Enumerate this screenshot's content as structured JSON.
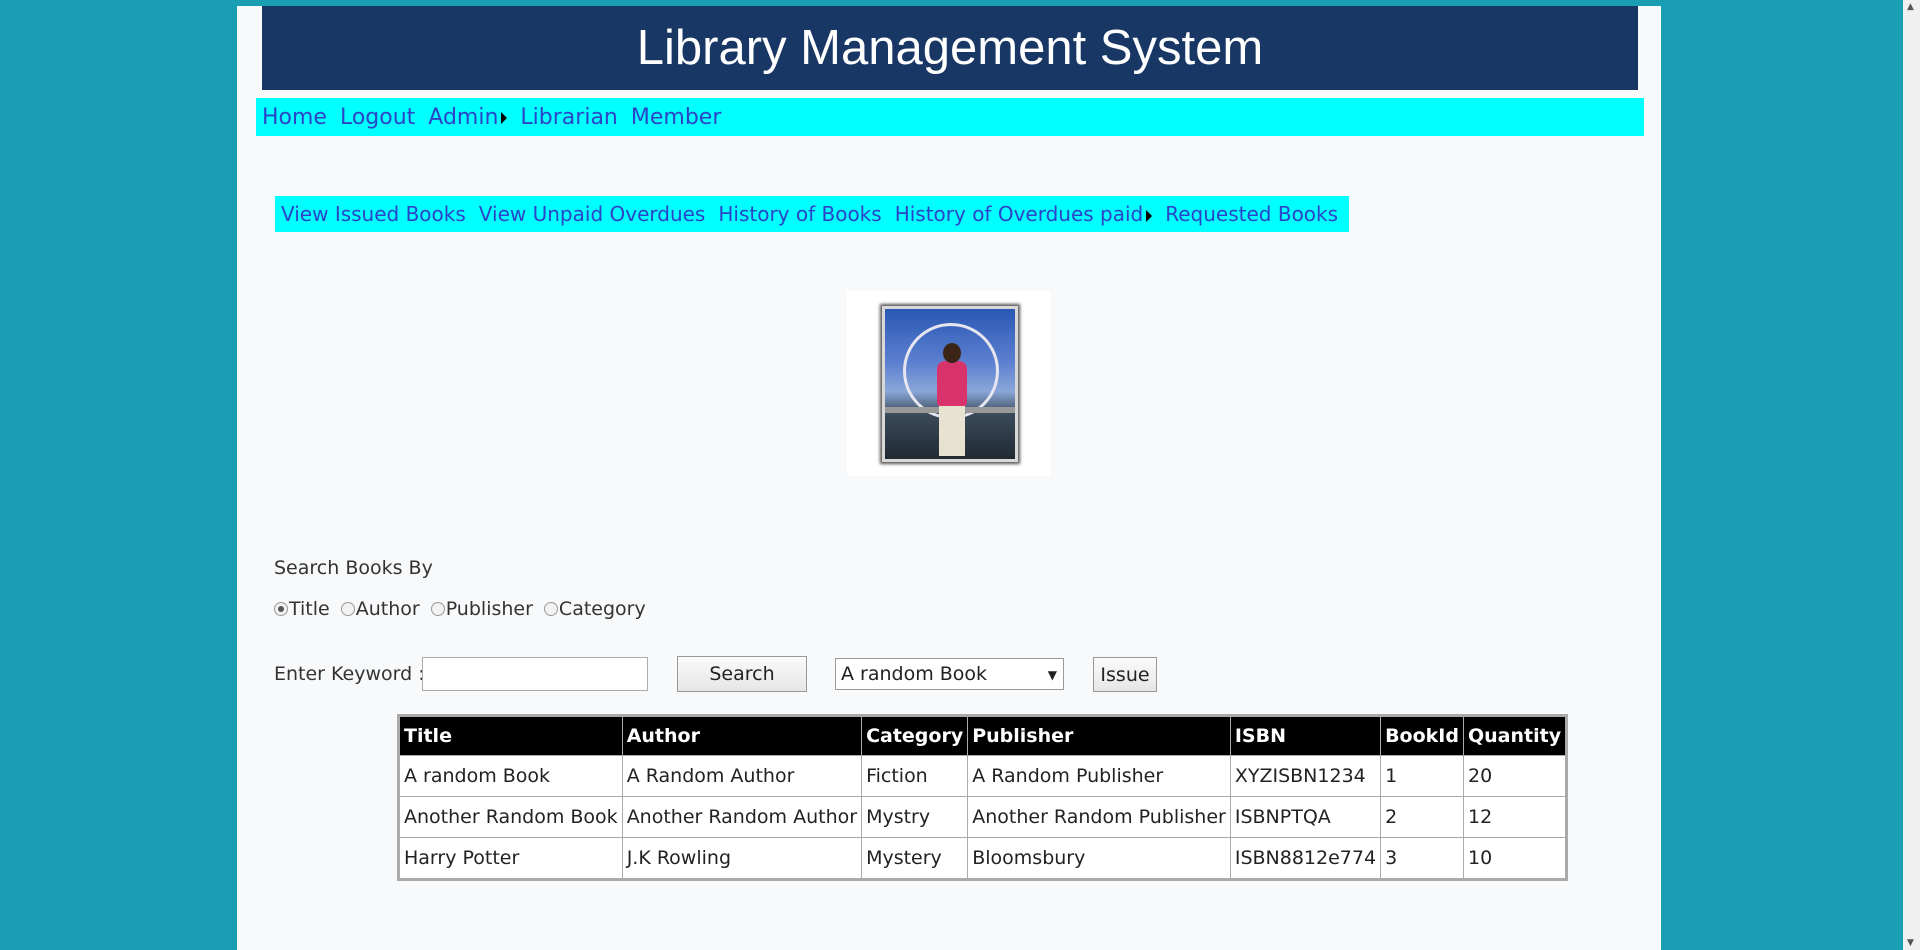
{
  "header": {
    "title": "Library Management System"
  },
  "topnav": {
    "items": [
      "Home",
      "Logout",
      "Admin",
      "Librarian",
      "Member"
    ]
  },
  "subnav": {
    "items": [
      "View Issued Books",
      "View Unpaid Overdues",
      "History of Books",
      "History of Overdues paid",
      "Requested Books"
    ]
  },
  "search": {
    "by_label": "Search Books By",
    "options": [
      "Title",
      "Author",
      "Publisher",
      "Category"
    ],
    "selected": "Title",
    "keyword_label": "Enter Keyword :",
    "keyword_value": "",
    "search_button": "Search",
    "book_select_value": "A random Book",
    "issue_button": "Issue"
  },
  "table": {
    "headers": [
      "Title",
      "Author",
      "Category",
      "Publisher",
      "ISBN",
      "BookId",
      "Quantity"
    ],
    "rows": [
      [
        "A random Book",
        "A Random Author",
        "Fiction",
        "A Random Publisher",
        "XYZISBN1234",
        "1",
        "20"
      ],
      [
        "Another Random Book",
        "Another Random Author",
        "Mystry",
        "Another Random Publisher",
        "ISBNPTQA",
        "2",
        "12"
      ],
      [
        "Harry Potter",
        "J.K Rowling",
        "Mystery",
        "Bloomsbury",
        "ISBN8812e774",
        "3",
        "10"
      ]
    ]
  },
  "colors": {
    "background": "#1a9eb3",
    "banner": "#183764",
    "nav": "#00ffff",
    "link": "#2b44c8"
  }
}
